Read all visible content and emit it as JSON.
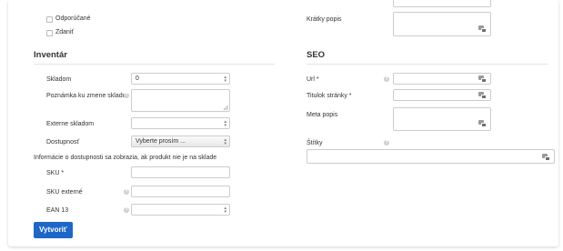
{
  "checkboxes": {
    "recommended": "Odporúčané",
    "taxed": "Zdaniť"
  },
  "inventory": {
    "title": "Inventár",
    "stock_label": "Skladom",
    "stock_value": "0",
    "stock_note_label": "Poznámka ku zmene skladu",
    "external_stock_label": "Externe skladom",
    "availability_label": "Dostupnosť",
    "availability_value": "Vyberte prosím ...",
    "availability_info": "Informácie o dostupnosti sa zobrazia, ak produkt nie je na sklade",
    "sku_label": "SKU *",
    "sku_external_label": "SKU externé",
    "ean_label": "EAN 13"
  },
  "short_desc_label": "Krátky popis",
  "seo": {
    "title": "SEO",
    "url_label": "Url *",
    "page_title_label": "Titulok stránky *",
    "meta_desc_label": "Meta popis"
  },
  "tags_label": "Štítky",
  "create_button": "Vytvoriť",
  "icons": {
    "help": "help-circle-icon",
    "translate": "translate-icon",
    "spinner": "spinner-arrows-icon",
    "resize": "resize-handle-icon"
  }
}
